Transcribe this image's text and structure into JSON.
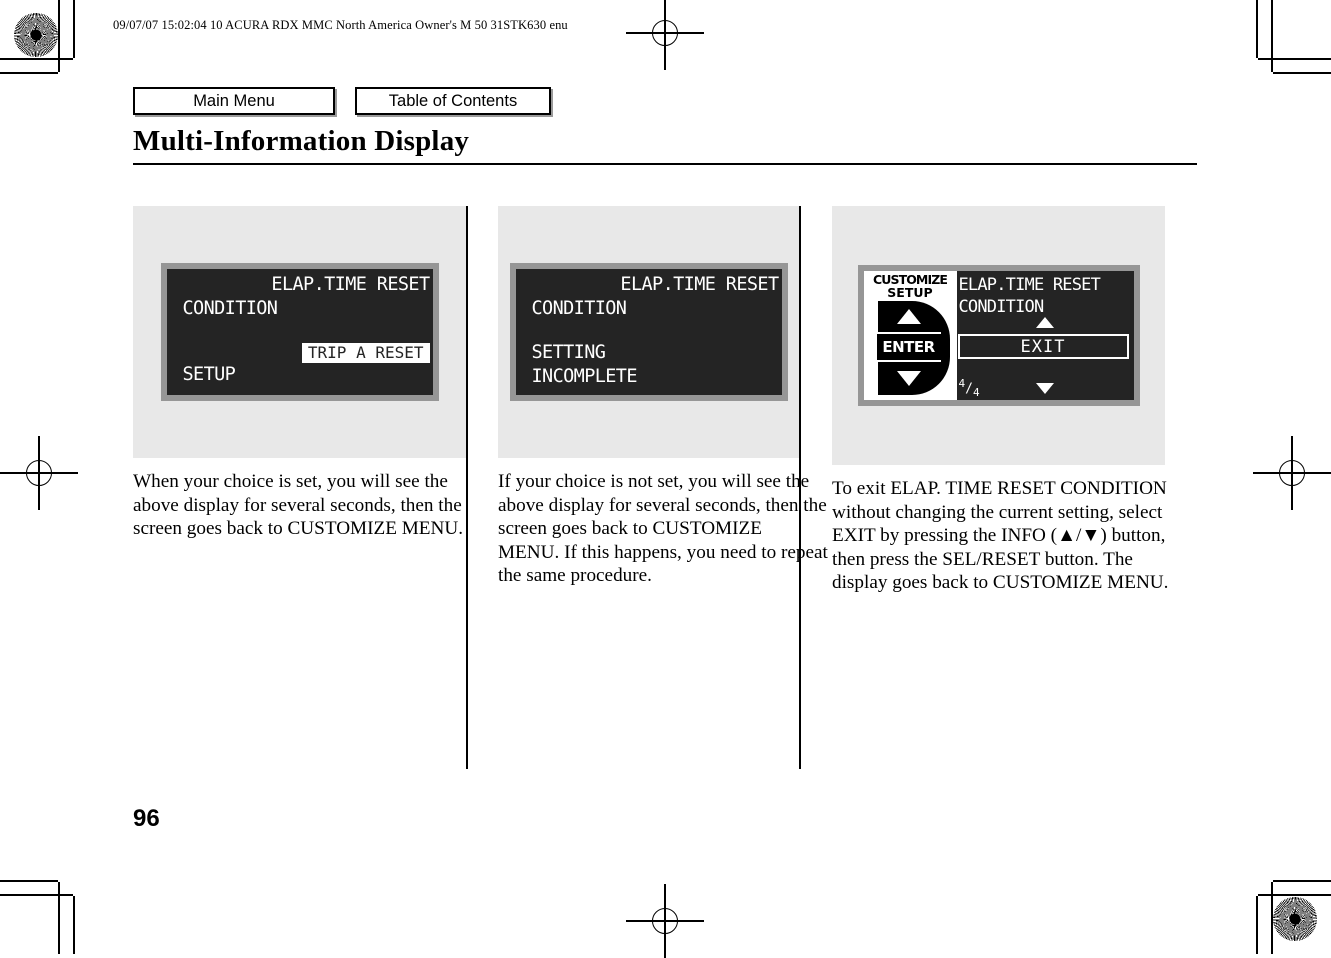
{
  "header": {
    "slug": "09/07/07 15:02:04    10 ACURA RDX MMC North America Owner's M 50 31STK630 enu"
  },
  "nav": {
    "main_menu_label": "Main Menu",
    "table_of_contents_label": "Table of Contents"
  },
  "page": {
    "title": "Multi-Information Display",
    "number": "96"
  },
  "columns": [
    {
      "screen": {
        "type": "simple",
        "line1": "ELAP.TIME RESET",
        "line2": "CONDITION",
        "highlight": "TRIP A RESET",
        "line4": "SETUP"
      },
      "text": "When your choice is set, you will see the above display for several seconds, then the screen goes back to CUSTOMIZE MENU."
    },
    {
      "screen": {
        "type": "simple",
        "line1": "ELAP.TIME RESET",
        "line2": "CONDITION",
        "line3": "SETTING",
        "line4": "INCOMPLETE"
      },
      "text": "If your choice is not set, you will see the above display for several seconds, then the screen goes back to CUSTOMIZE MENU. If this happens, you need to repeat the same procedure."
    },
    {
      "screen": {
        "type": "customize",
        "sidebar_title_line1": "CUSTOMIZE",
        "sidebar_title_line2": "SETUP",
        "enter_label": "ENTER",
        "line1": "ELAP.TIME RESET",
        "line2": "CONDITION",
        "selection": "EXIT",
        "page_indicator": "4/4",
        "page_indicator_num": "4",
        "page_indicator_den": "4"
      },
      "text": "To exit ELAP. TIME RESET CONDITION without changing the current setting, select EXIT by pressing the INFO (▲/▼) button, then press the SEL/RESET button. The display goes back to CUSTOMIZE MENU."
    }
  ],
  "colors": {
    "figure_background": "#e8e8e8",
    "lcd_bezel": "#969696",
    "lcd_screen": "#242424",
    "lcd_text": "#ffffff"
  }
}
